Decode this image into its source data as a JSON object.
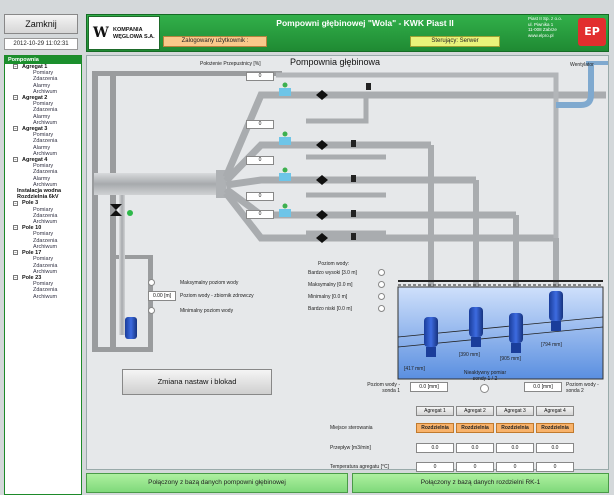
{
  "top": {
    "close_label": "Zamknij",
    "datetime": "2012-10-29 11:02:31"
  },
  "header": {
    "company_name": "KOMPANIA WĘGLOWA S.A.",
    "title": "Pompowni głębinowej \"Wola\" - KWK Piast II",
    "logged_user_label": "Zalogowany użytkownik :",
    "control_label": "Sterujący: Serwer",
    "company_info_lines": [
      "Piast II Sp. z o.o.",
      "ul. Piwnika 1",
      "11-008 Zabrze",
      "www.elpro.pl"
    ],
    "brand_logo_text": "EP"
  },
  "sidebar": {
    "root": "Pompownia",
    "items": [
      {
        "label": "Agregat 1",
        "level": 1
      },
      {
        "label": "Pomiary",
        "level": 2
      },
      {
        "label": "Zdarzenia",
        "level": 2
      },
      {
        "label": "Alarmy",
        "level": 2
      },
      {
        "label": "Archiwum",
        "level": 2
      },
      {
        "label": "Agregat 2",
        "level": 1
      },
      {
        "label": "Pomiary",
        "level": 2
      },
      {
        "label": "Zdarzenia",
        "level": 2
      },
      {
        "label": "Alarmy",
        "level": 2
      },
      {
        "label": "Archiwum",
        "level": 2
      },
      {
        "label": "Agregat 3",
        "level": 1
      },
      {
        "label": "Pomiary",
        "level": 2
      },
      {
        "label": "Zdarzenia",
        "level": 2
      },
      {
        "label": "Alarmy",
        "level": 2
      },
      {
        "label": "Archiwum",
        "level": 2
      },
      {
        "label": "Agregat 4",
        "level": 1
      },
      {
        "label": "Pomiary",
        "level": 2
      },
      {
        "label": "Zdarzenia",
        "level": 2
      },
      {
        "label": "Alarmy",
        "level": 2
      },
      {
        "label": "Archiwum",
        "level": 2
      },
      {
        "label": "Instalacja wodna",
        "level": 0
      },
      {
        "label": "Rozdzielnia 6kV",
        "level": 0
      },
      {
        "label": "Pole 3",
        "level": 1
      },
      {
        "label": "Pomiary",
        "level": 2
      },
      {
        "label": "Zdarzenia",
        "level": 2
      },
      {
        "label": "Archiwum",
        "level": 2
      },
      {
        "label": "Pole 10",
        "level": 1
      },
      {
        "label": "Pomiary",
        "level": 2
      },
      {
        "label": "Zdarzenia",
        "level": 2
      },
      {
        "label": "Archiwum",
        "level": 2
      },
      {
        "label": "Pole 17",
        "level": 1
      },
      {
        "label": "Pomiary",
        "level": 2
      },
      {
        "label": "Zdarzenia",
        "level": 2
      },
      {
        "label": "Archiwum",
        "level": 2
      },
      {
        "label": "Pole 23",
        "level": 1
      },
      {
        "label": "Pomiary",
        "level": 2
      },
      {
        "label": "Zdarzenia",
        "level": 2
      },
      {
        "label": "Archiwum",
        "level": 2
      }
    ]
  },
  "main": {
    "title": "Pompownia głębinowa",
    "inclination_label": "Położenie Przepustnicy [%]",
    "vent_label": "Wentylator",
    "valve_values": [
      "0",
      "0",
      "0",
      "0",
      "0"
    ],
    "water_level_title": "Poziom wody:",
    "water_levels": [
      "Bardzo wysoki [3.0 m]",
      "Maksymalny [0.0 m]",
      "Minimalny [0.0 m]",
      "Bardzo niski [0.0 m]"
    ],
    "sump_labels": {
      "max": "Maksymalny poziom wody",
      "level": "Poziom wody - zbiornik zdrowczy",
      "min": "Minimalny poziom wody",
      "level_value": "0.00 [m]"
    },
    "depth_tags": [
      "[417 mm]",
      "[390 mm]",
      "[905 mm]",
      "[794 mm]"
    ],
    "probe": {
      "left_label": "Poziom wody - sonda 1",
      "left_value": "0.0 [mm]",
      "right_label": "Poziom wody - sonda 2",
      "right_value": "0.0 [mm]",
      "switch_label": "Nieaktywny pomiar sondy 1 / 2"
    },
    "change_button": "Zmiana nastaw i blokad"
  },
  "pumps": {
    "headers": [
      "Agregat 1",
      "Agregat 2",
      "Agregat 3",
      "Agregat 4"
    ],
    "rows": [
      {
        "label": "Miejsce sterowania",
        "values": [
          "Rozdzielnia",
          "Rozdzielnia",
          "Rozdzielnia",
          "Rozdzielnia"
        ],
        "style": "orange"
      },
      {
        "label": "Przepływ [m3/min]",
        "values": [
          "0.0",
          "0.0",
          "0.0",
          "0.0"
        ],
        "style": "cell"
      },
      {
        "label": "Temperatura agregatu [°C]",
        "values": [
          "0",
          "0",
          "0",
          "0"
        ],
        "style": "cell"
      }
    ]
  },
  "status": {
    "left": "Połączony z bazą danych pompowni głębinowej",
    "right": "Połączony z bazą danych rozdzielni RK-1"
  },
  "colors": {
    "header_green": "#1f8a33",
    "status_green": "#8fe08a",
    "orange": "#f8b26a",
    "pipe": "#b9bcbf",
    "water": "#6aa0e6"
  }
}
